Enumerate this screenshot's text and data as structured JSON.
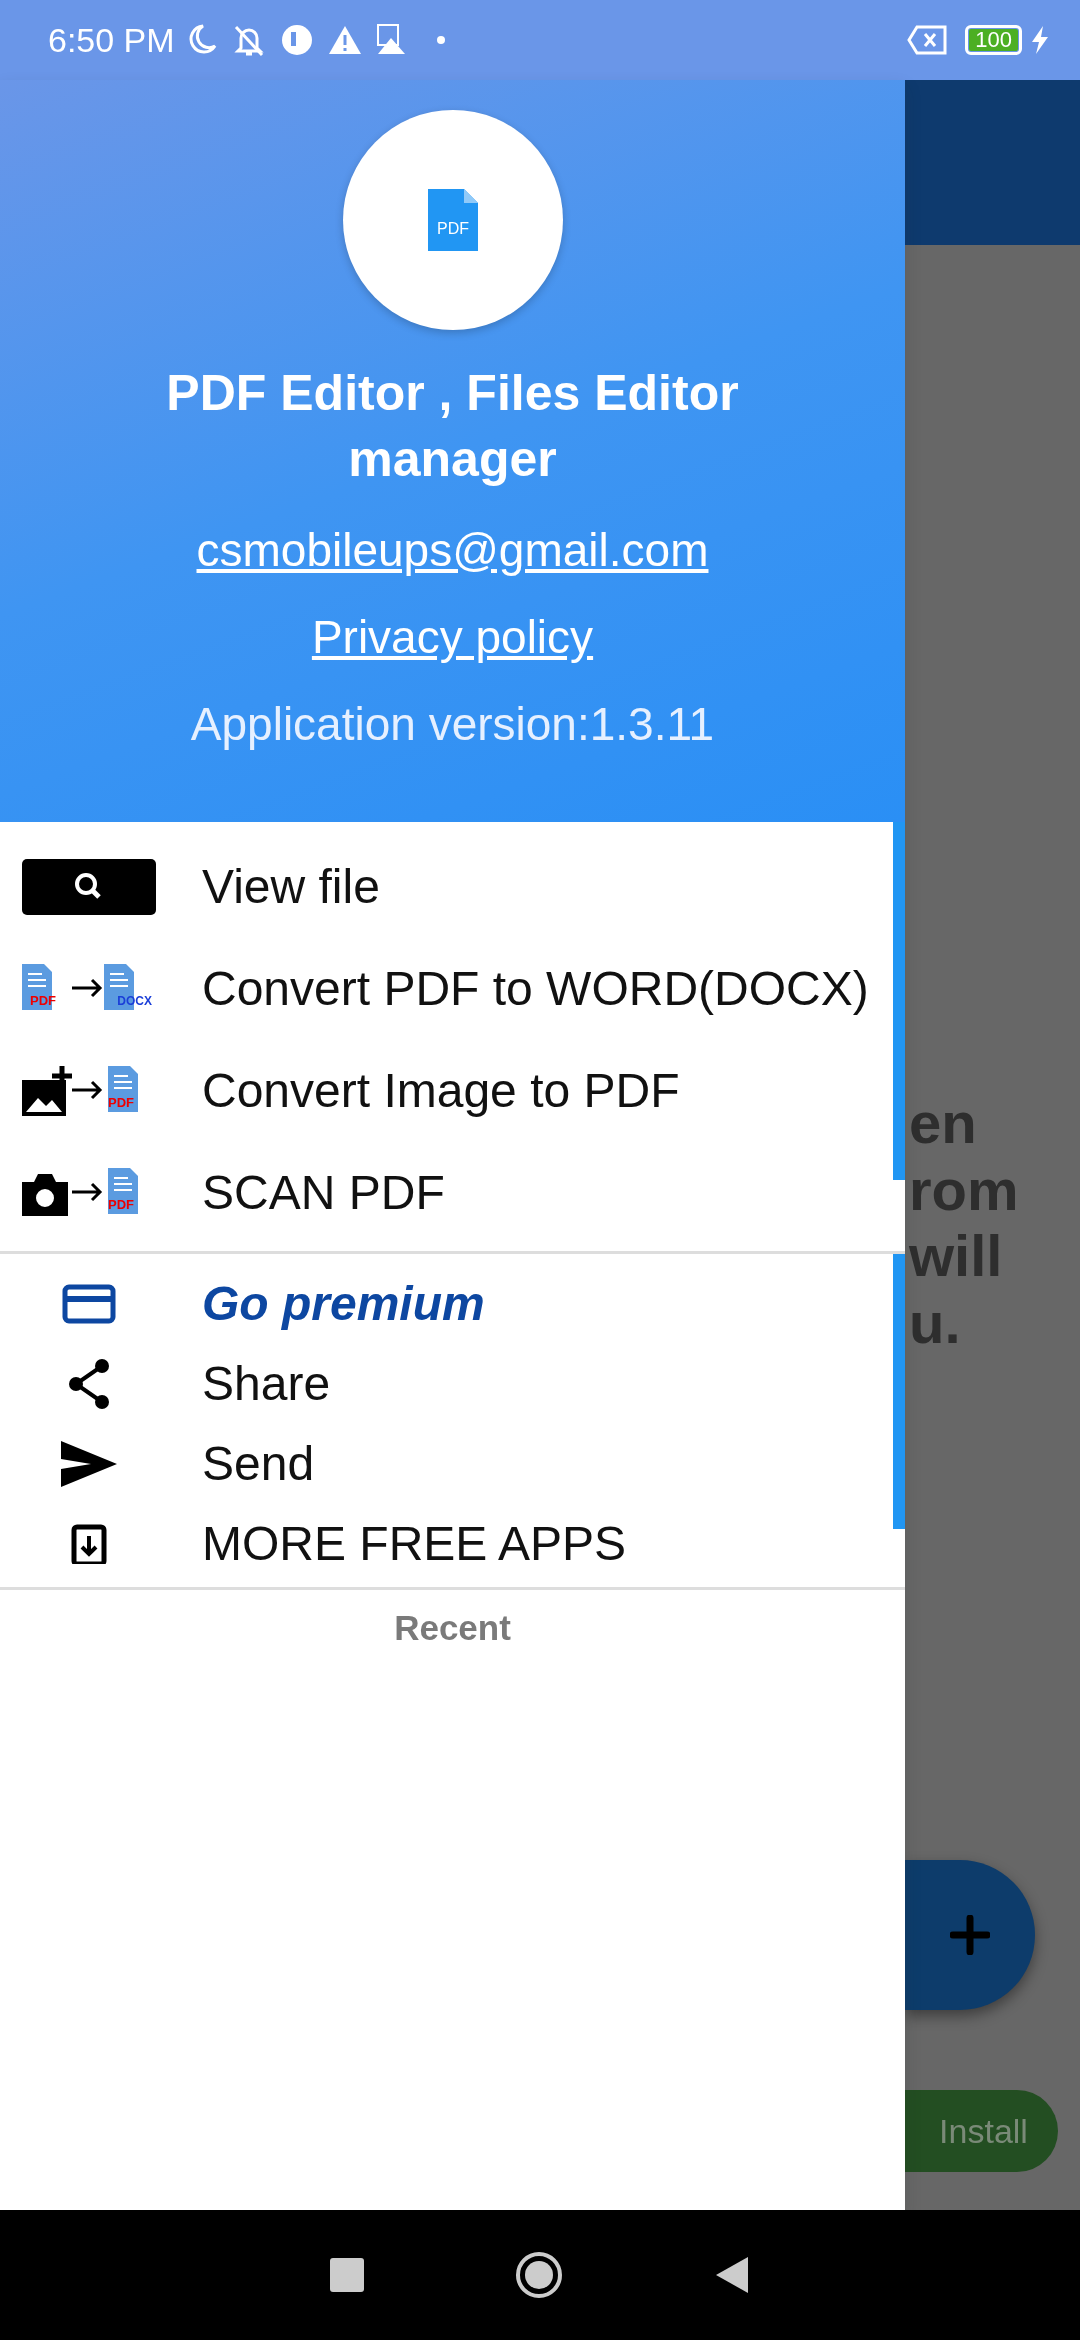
{
  "status_bar": {
    "time": "6:50 PM",
    "battery": "100"
  },
  "drawer": {
    "logo_label": "PDF",
    "app_name": "PDF Editor , Files Editor manager",
    "email": "csmobileups@gmail.com",
    "privacy_link": "Privacy policy",
    "version": "Application version:1.3.11",
    "tools": [
      {
        "kind": "search",
        "label": "View file"
      },
      {
        "kind": "pdf-to-docx",
        "label": "Convert PDF to WORD(DOCX)",
        "from_label": "PDF",
        "to_label": "DOCX"
      },
      {
        "kind": "image-to-pdf",
        "label": "Convert Image to PDF",
        "to_label": "PDF"
      },
      {
        "kind": "camera-to-pdf",
        "label": "SCAN PDF",
        "to_label": "PDF"
      }
    ],
    "actions": [
      {
        "kind": "card",
        "label": "Go premium",
        "highlighted": true
      },
      {
        "kind": "share",
        "label": "Share",
        "highlighted": false
      },
      {
        "kind": "send",
        "label": "Send",
        "highlighted": false
      },
      {
        "kind": "download",
        "label": "MORE FREE APPS",
        "highlighted": false
      }
    ],
    "recent_heading": "Recent"
  },
  "background": {
    "text_lines": [
      "en",
      "rom",
      "will",
      "u."
    ],
    "install_button": "Install"
  }
}
